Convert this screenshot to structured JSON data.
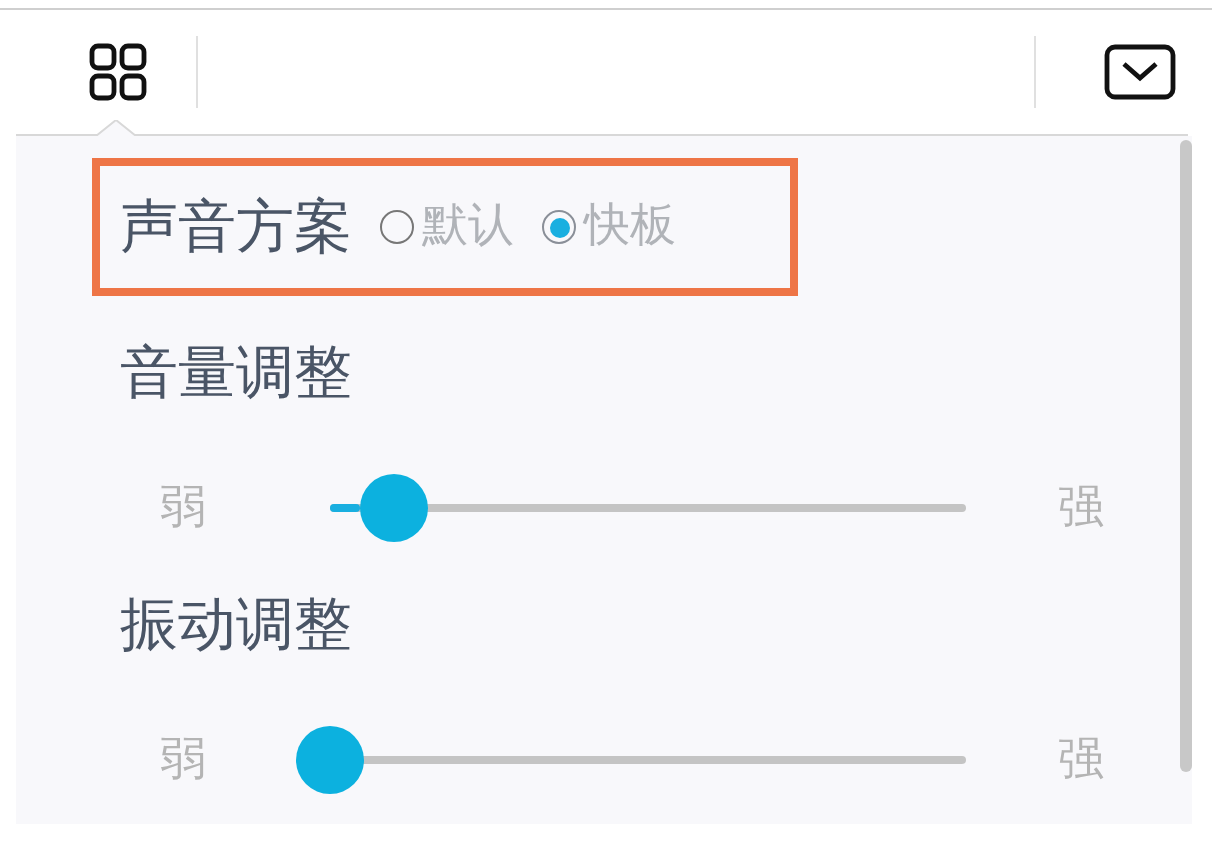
{
  "sound_scheme": {
    "title": "声音方案",
    "options": [
      {
        "label": "默认",
        "selected": false
      },
      {
        "label": "快板",
        "selected": true
      }
    ]
  },
  "sliders": [
    {
      "title": "音量调整",
      "min_label": "弱",
      "max_label": "强",
      "level": 0.1
    },
    {
      "title": "振动调整",
      "min_label": "弱",
      "max_label": "强",
      "level": 0
    }
  ]
}
